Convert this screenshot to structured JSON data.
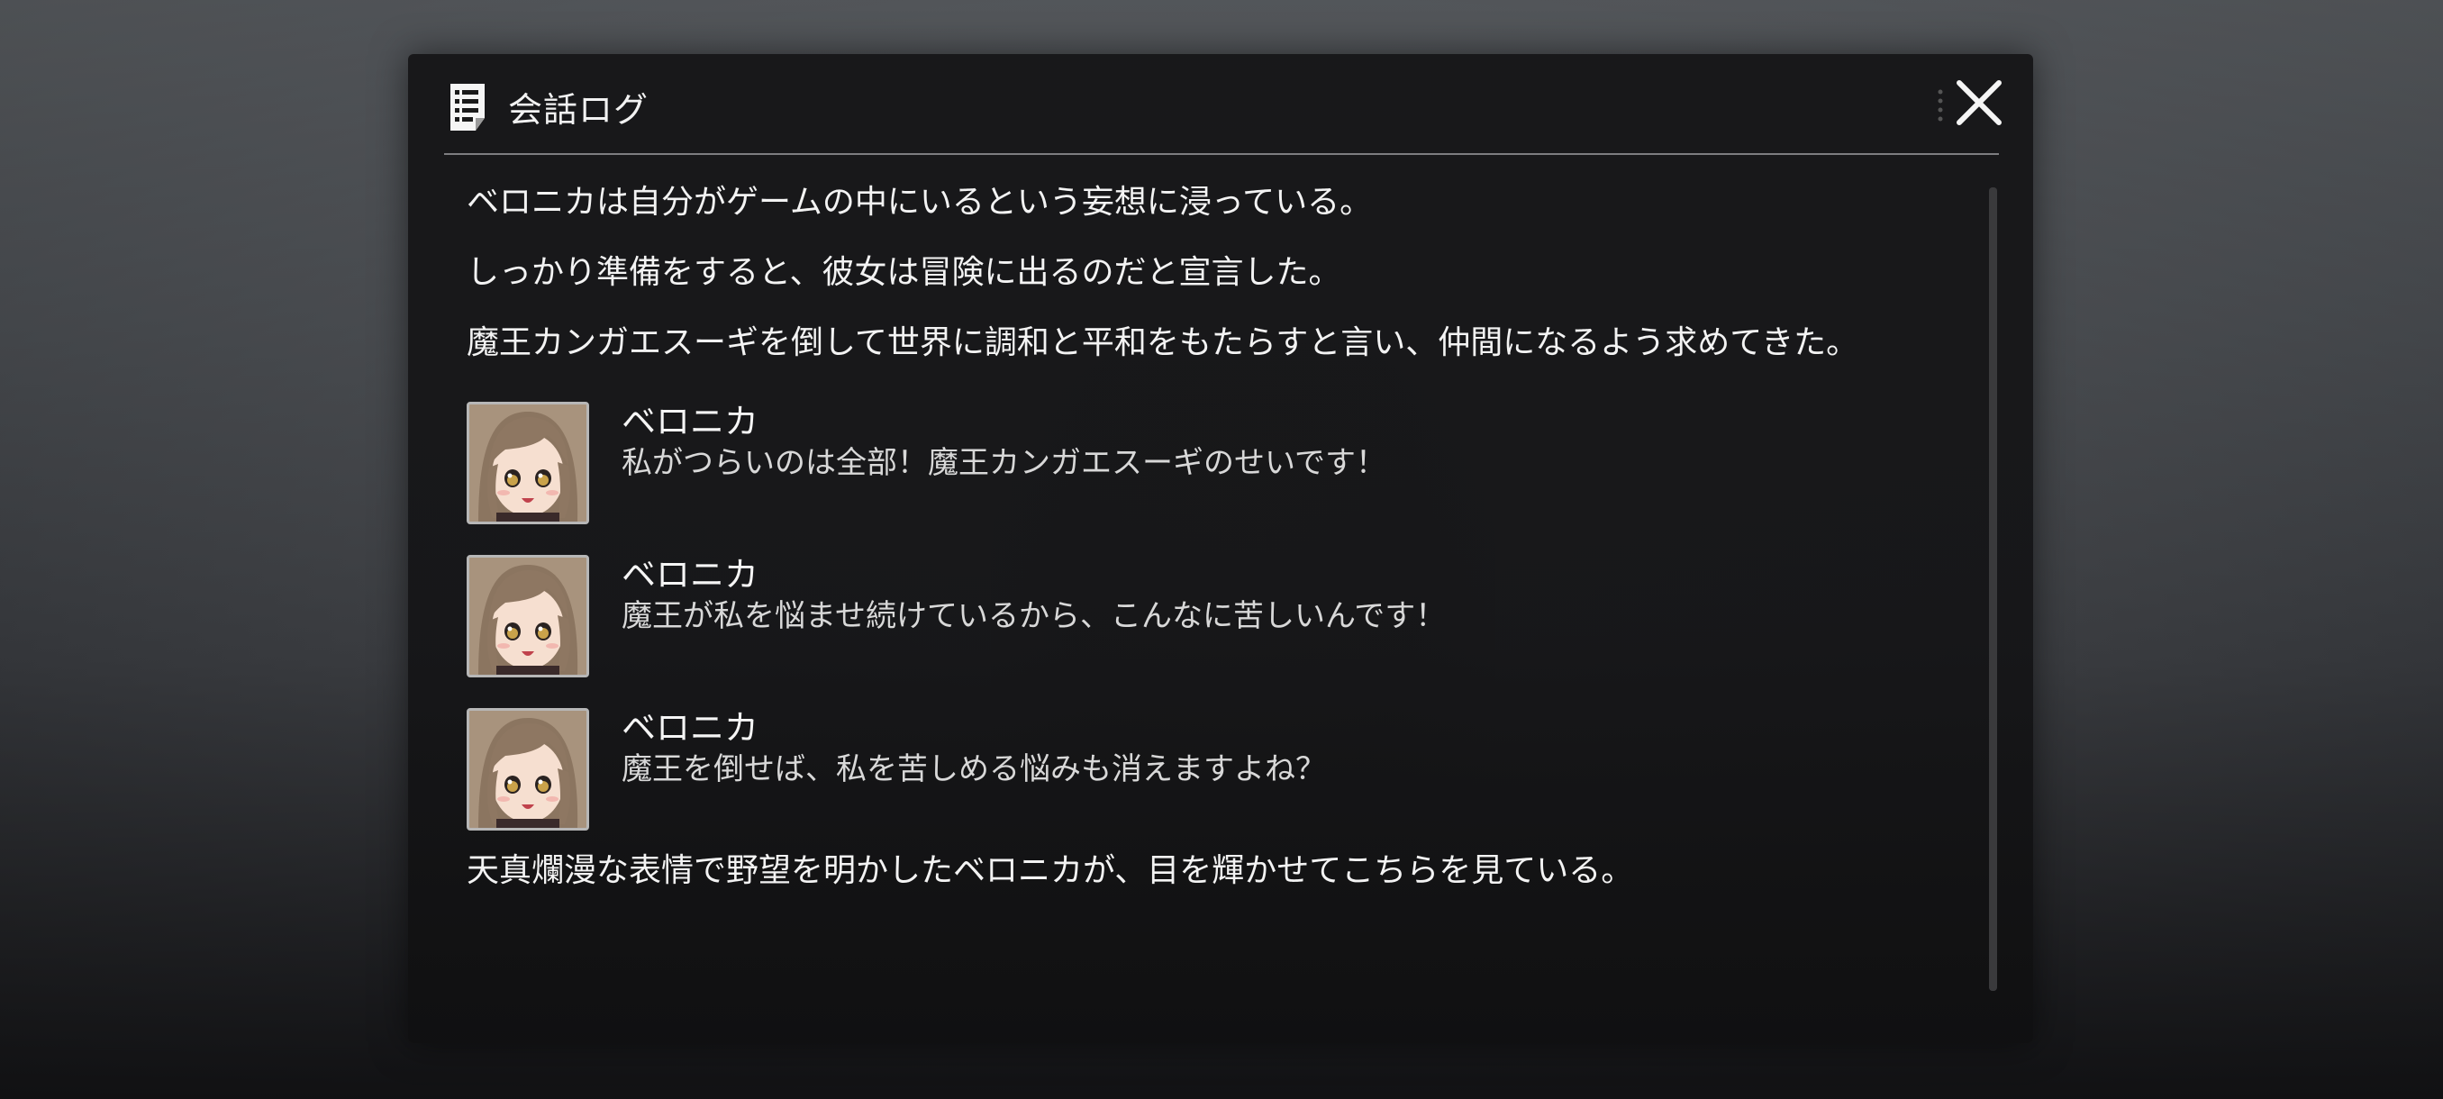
{
  "dialog": {
    "title": "会話ログ",
    "icon": "log-document-icon",
    "close_icon": "close-icon"
  },
  "log": {
    "narration_before": [
      "ベロニカは自分がゲームの中にいるという妄想に浸っている。",
      "しっかり準備をすると、彼女は冒険に出るのだと宣言した。",
      "魔王カンガエスーギを倒して世界に調和と平和をもたらすと言い、仲間になるよう求めてきた。"
    ],
    "speeches": [
      {
        "speaker": "ベロニカ",
        "text": "私がつらいのは全部！魔王カンガエスーギのせいです！",
        "portrait": "veronica-portrait"
      },
      {
        "speaker": "ベロニカ",
        "text": "魔王が私を悩ませ続けているから、こんなに苦しいんです！",
        "portrait": "veronica-portrait"
      },
      {
        "speaker": "ベロニカ",
        "text": "魔王を倒せば、私を苦しめる悩みも消えますよね？",
        "portrait": "veronica-portrait"
      }
    ],
    "narration_after": [
      "天真爛漫な表情で野望を明かしたベロニカが、目を輝かせてこちらを見ている。"
    ]
  },
  "colors": {
    "panel": "#161618",
    "text": "#f3f3f3",
    "divider": "#7d7d80",
    "portrait_border": "#b7b7b7"
  }
}
